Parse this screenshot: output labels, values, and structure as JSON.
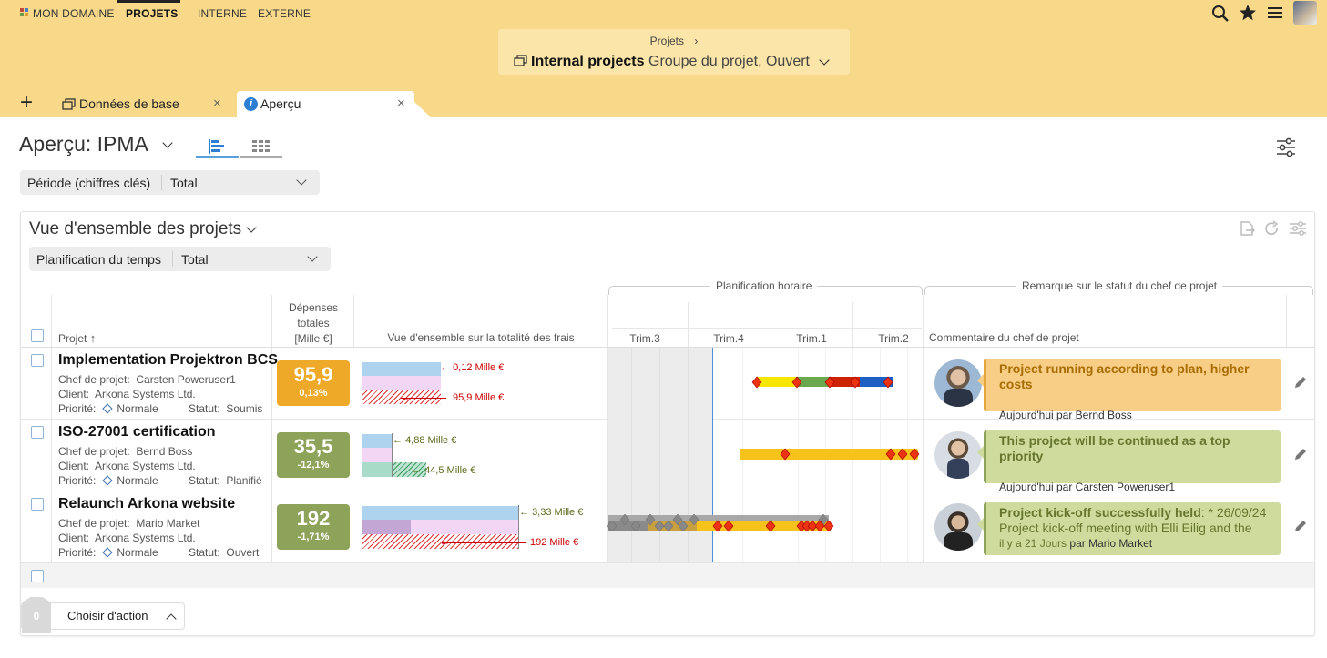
{
  "nav": {
    "items": [
      "MON DOMAINE",
      "PROJETS",
      "INTERNE",
      "EXTERNE"
    ]
  },
  "header": {
    "breadcrumb": "Projets",
    "breadcrumb_sep": "›",
    "title": "Internal projects",
    "subtitle": "Groupe du projet, Ouvert"
  },
  "tabs": {
    "add": "+",
    "items": [
      {
        "label": "Données de base",
        "close": "×"
      },
      {
        "label": "Aperçu",
        "close": "×"
      }
    ]
  },
  "view": {
    "title": "Aperçu: IPMA",
    "period_label": "Période (chiffres clés)",
    "period_value": "Total"
  },
  "panel": {
    "title": "Vue d'ensemble des projets",
    "filter_label": "Planification du temps",
    "filter_value": "Total",
    "group_planning": "Planification horaire",
    "group_status": "Remarque sur le statut du chef de projet",
    "col_project": "Projet",
    "col_project_sort": "↑",
    "col_expenses_line1": "Dépenses",
    "col_expenses_line2": "totales",
    "col_expenses_line3": "[Mille €]",
    "col_overview": "Vue d'ensemble sur la totalité des frais",
    "quarters": [
      "Trim.3",
      "Trim.4",
      "Trim.1",
      "Trim.2"
    ],
    "col_comment": "Commentaire du chef de projet",
    "action_count": "0",
    "action_label": "Choisir d'action"
  },
  "labels": {
    "manager": "Chef de projet:",
    "client": "Client:",
    "priority": "Priorité:",
    "status": "Statut:"
  },
  "projects": [
    {
      "name": "Implementation Projektron BCS",
      "manager": "Carsten Poweruser1",
      "client": "Arkona Systems Ltd.",
      "priority": "Normale",
      "status": "Soumis",
      "kpi_value": "95,9",
      "kpi_pct": "0,13%",
      "kpi_color": "#eda927",
      "cost_top": "0,12 Mille €",
      "cost_bottom": "95,9 Mille €",
      "comment_title": "Project running according to plan, higher costs",
      "comment_body": "",
      "comment_by": "Aujourd'hui par Bernd Boss",
      "bubble_color": "#f8cd86",
      "title_color": "#a86d00"
    },
    {
      "name": "ISO-27001 certification",
      "manager": "Bernd Boss",
      "client": "Arkona Systems Ltd.",
      "priority": "Normale",
      "status": "Planifié",
      "kpi_value": "35,5",
      "kpi_pct": "-12,1%",
      "kpi_color": "#8ea35a",
      "cost_top": "4,88 Mille €",
      "cost_bottom": "44,5 Mille €",
      "comment_title": "This project will be continued as a top priority",
      "comment_body": "",
      "comment_by": "Aujourd'hui par Carsten Poweruser1",
      "bubble_color": "#cedb9d",
      "title_color": "#66762f"
    },
    {
      "name": "Relaunch Arkona website",
      "manager": "Mario Market",
      "client": "Arkona Systems Ltd.",
      "priority": "Normale",
      "status": "Ouvert",
      "kpi_value": "192",
      "kpi_pct": "-1,71%",
      "kpi_color": "#8ea35a",
      "cost_top": "3,33 Mille €",
      "cost_bottom": "192 Mille €",
      "comment_title": "Project kick-off successfully held",
      "comment_title_extra": ": * 26/09/24",
      "comment_body": "Project kick-off meeting with Elli Eilig and the",
      "comment_by_time": "il y a 21 Jours",
      "comment_by": "par Mario Market",
      "bubble_color": "#cedb9d",
      "title_color": "#66762f"
    }
  ]
}
